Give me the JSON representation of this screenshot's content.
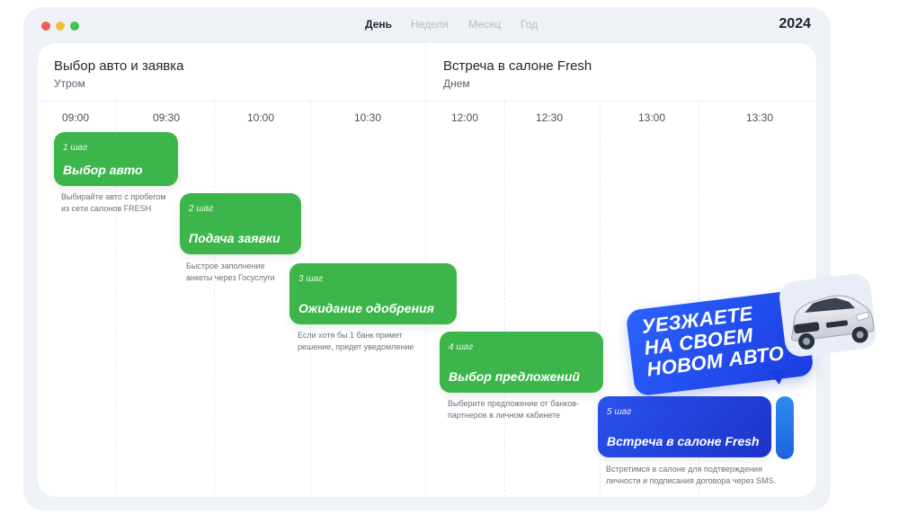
{
  "window": {
    "tabs": [
      "День",
      "Неделя",
      "Месяц",
      "Год"
    ],
    "active_tab_index": 0,
    "year": "2024"
  },
  "sections": [
    {
      "title": "Выбор авто и заявка",
      "subtitle": "Утром"
    },
    {
      "title": "Встреча в салоне Fresh",
      "subtitle": "Днем"
    }
  ],
  "times": [
    "09:00",
    "09:30",
    "10:00",
    "10:30",
    "12:00",
    "12:30",
    "13:00",
    "13:30"
  ],
  "steps": [
    {
      "num": "1 шаг",
      "title": "Выбор авто",
      "desc_lines": [
        "Выбирайте авто с пробегом",
        "из сети салонов FRESH"
      ],
      "color": "#3cb54a"
    },
    {
      "num": "2 шаг",
      "title": "Подача заявки",
      "desc_lines": [
        "Быстрое заполнение",
        "анкеты через Госуслуги"
      ],
      "color": "#3cb54a"
    },
    {
      "num": "3 шаг",
      "title": "Ожидание одобрения",
      "desc_lines": [
        "Если хотя бы 1 банк примет",
        "решение, придет уведомление"
      ],
      "color": "#3cb54a"
    },
    {
      "num": "4 шаг",
      "title": "Выбор предложений",
      "desc_lines": [
        "Выберите предложение от банков-",
        "партнеров в личном кабинете"
      ],
      "color": "#3cb54a"
    },
    {
      "num": "5 шаг",
      "title": "Встреча в салоне Fresh",
      "desc_lines": [
        "Встретимся в салоне для подтверждения",
        "личности и подписания договора через SMS."
      ],
      "color": "#1f3fd8"
    }
  ],
  "promo": {
    "lines": [
      "Уезжаете",
      "на своем",
      "новом авто"
    ]
  },
  "colors": {
    "green": "#3cb54a",
    "blue": "#1f3fd8",
    "accent_light_blue": "#2d8cf0"
  },
  "icons": {
    "window_controls": [
      "close-dot",
      "minimize-dot",
      "zoom-dot"
    ],
    "car": "car-illustration"
  }
}
